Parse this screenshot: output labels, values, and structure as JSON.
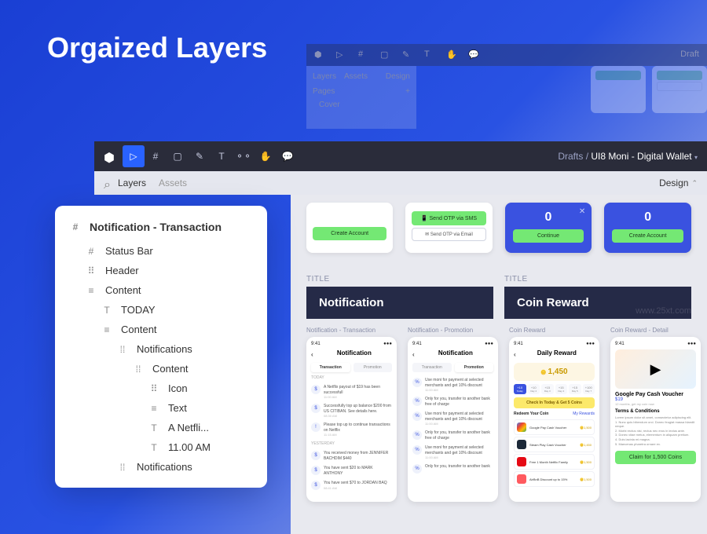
{
  "hero": "Orgaized Layers",
  "watermark": "www.25xt.com",
  "bg": {
    "layers": "Layers",
    "assets": "Assets",
    "design": "Design",
    "pages": "Pages",
    "cover": "Cover",
    "drafts": "Draft"
  },
  "toolbar": {
    "crumb_drafts": "Drafts",
    "crumb_sep": " / ",
    "crumb_project": "UI8 Moni - Digital Wallet"
  },
  "subheader": {
    "layers": "Layers",
    "assets": "Assets",
    "design": "Design"
  },
  "layers": {
    "root": "Notification - Transaction",
    "items": [
      {
        "icon": "#",
        "label": "Status Bar",
        "indent": 1
      },
      {
        "icon": "⠿",
        "label": "Header",
        "indent": 1
      },
      {
        "icon": "≡",
        "label": "Content",
        "indent": 1
      },
      {
        "icon": "T",
        "label": "TODAY",
        "indent": 2
      },
      {
        "icon": "≡",
        "label": "Content",
        "indent": 2
      },
      {
        "icon": "⁞⁞",
        "label": "Notifications",
        "indent": 3
      },
      {
        "icon": "⁞⁞",
        "label": "Content",
        "indent": 4
      },
      {
        "icon": "⠿",
        "label": "Icon",
        "indent": 5
      },
      {
        "icon": "≡",
        "label": "Text",
        "indent": 5
      },
      {
        "icon": "T",
        "label": "A Netfli...",
        "indent": 5
      },
      {
        "icon": "T",
        "label": "11.00 AM",
        "indent": 5
      },
      {
        "icon": "⁞⁞",
        "label": "Notifications",
        "indent": 3
      }
    ]
  },
  "top_cards": {
    "c1": {
      "btn": "Create Account"
    },
    "c2": {
      "b1": "Send OTP via SMS",
      "b2": "Send OTP via Email"
    },
    "c3": {
      "zero": "0",
      "btn": "Continue"
    },
    "c4": {
      "zero": "0",
      "btn": "Create Account"
    }
  },
  "sections": {
    "title_label": "TITLE",
    "notification": "Notification",
    "coin_reward": "Coin Reward"
  },
  "screens": {
    "s1": {
      "name": "Notification - Transaction",
      "time": "9:41",
      "title": "Notification",
      "tab1": "Transaction",
      "tab2": "Promotion",
      "today": "TODAY",
      "yesterday": "YESTERDAY",
      "n1": "A Netflix payout of $19 has been successfull",
      "t1": "11:00 AM",
      "n2": "Successfully top up balance $200 from US CITIBAN. See details here.",
      "t2": "08:30 AM",
      "n3": "Please top up to continue transactions on Netflix",
      "t3": "11:15 AM",
      "n4": "You received money from JENNIFER BACHDIM $440",
      "t4": "",
      "n5": "You have sent $20 to MARK ANTHONY",
      "t5": "",
      "n6": "You have sent $70 to JORDAN BAQ",
      "t6": "08:41 AM"
    },
    "s2": {
      "name": "Notification - Promotion",
      "time": "9:41",
      "title": "Notification",
      "tab1": "Transaction",
      "tab2": "Promotion",
      "p1": "Use moni for payment at selected merchants and get 10% discount",
      "pt1": "11:00 AM",
      "p2": "Only for you, transfer to another bank free of charge",
      "pt2": "",
      "p3": "Use moni for payment at selected merchants and get 10% discount",
      "pt3": "11:00 AM",
      "p4": "Only for you, transfer to another bank free of charge",
      "pt4": "",
      "p5": "Use moni for payment at selected merchants and get 10% discount",
      "pt5": "11:00 AM",
      "p6": "Only for you, transfer to another bank",
      "pt6": ""
    },
    "s3": {
      "name": "Coin Reward",
      "time": "9:41",
      "title": "Daily Reward",
      "amount": "1,450",
      "days": [
        "+10",
        "+10",
        "+15",
        "+15",
        "+15",
        "+100"
      ],
      "daylabels": [
        "Today",
        "Day 2",
        "Day 3",
        "Day 4",
        "Day 5",
        "Day 7"
      ],
      "check": "Check In Today & Get 5 Coins",
      "redeem": "Redeem Your Coin",
      "myrewards": "My Rewards",
      "r1": {
        "name": "Google Pay Cash Voucher",
        "cost": "1,500"
      },
      "r2": {
        "name": "Steam Play Cash Voucher",
        "cost": "1,450"
      },
      "r3": {
        "name": "Free 1 Month Netflix Family",
        "cost": "1,500"
      },
      "r4": {
        "name": "AirBnB Discount up to 15%",
        "cost": "1,500"
      }
    },
    "s4": {
      "name": "Coin Reward - Detail",
      "time": "9:41",
      "vtitle": "Google Pay Cash Voucher",
      "vprice": "$19",
      "vsub": "12 months, get my coin now",
      "terms": "Terms & Conditions",
      "lorem": "Lorem ipsum dolor sit amet, consectetur adipiscing elit.",
      "li1": "1. Nunc quis bibendum orci. Donec feugiat massa blandit neque.",
      "li2": "2. Morbi rectus nisi, rectus nec eros in lectus ante.",
      "li3": "3. Donec vitae metus, elementum in aliquam pretium.",
      "li4": "4. Duis lacinia mi magna.",
      "li5": "5. Maecenas pharetra ornare ex.",
      "claim": "Claim for 1,500 Coins"
    }
  }
}
